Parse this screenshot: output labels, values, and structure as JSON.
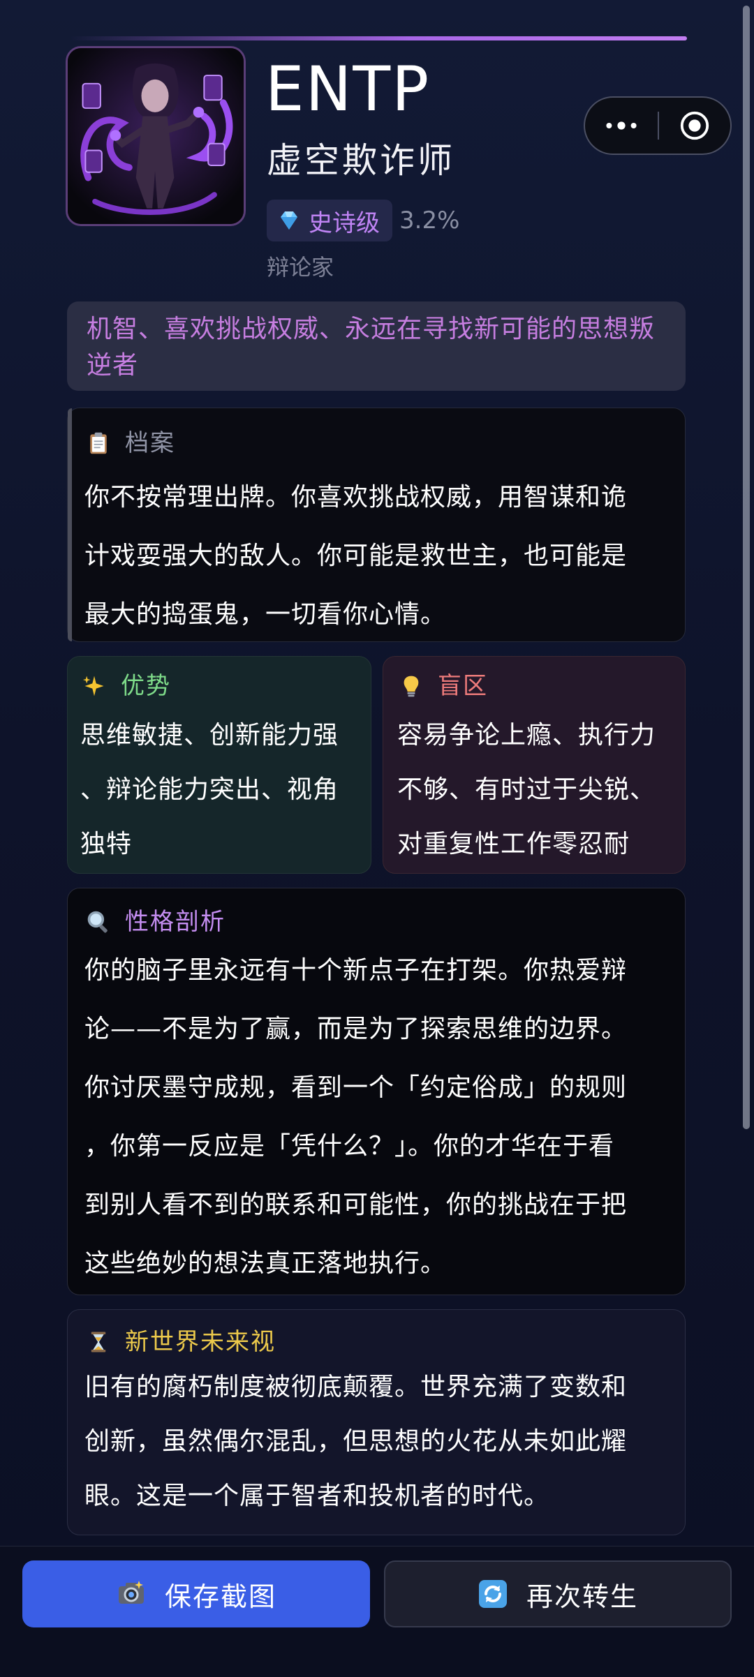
{
  "header": {
    "title": "ENTP",
    "subtitle": "虚空欺诈师",
    "rarity": "史诗级",
    "percent": "3.2%",
    "nickname": "辩论家",
    "avatar_icon": "void-trickster-portrait",
    "accent_color": "#a766e6"
  },
  "capsule": {
    "more_icon": "more-dots-icon",
    "close_icon": "target-close-icon"
  },
  "tagline": "机智、喜欢挑战权威、永远在寻找新可能的思想叛逆者",
  "profile": {
    "icon": "clipboard-icon",
    "title": "档案",
    "lines": [
      "你不按常理出牌。你喜欢挑战权威，用智谋和诡",
      "计戏耍强大的敌人。你可能是救世主，也可能是",
      "最大的捣蛋鬼，一切看你心情。"
    ]
  },
  "strengths": {
    "icon": "sparkles-icon",
    "title": "优势",
    "lines": [
      "思维敏捷、创新能力强",
      "、辩论能力突出、视角",
      "独特"
    ]
  },
  "blindspots": {
    "icon": "lightbulb-icon",
    "title": "盲区",
    "lines": [
      "容易争论上瘾、执行力",
      "不够、有时过于尖锐、",
      "对重复性工作零忍耐"
    ]
  },
  "analysis": {
    "icon": "magnifier-icon",
    "title": "性格剖析",
    "lines": [
      "你的脑子里永远有十个新点子在打架。你热爱辩",
      "论——不是为了赢，而是为了探索思维的边界。",
      "你讨厌墨守成规，看到一个「约定俗成」的规则",
      "，你第一反应是「凭什么？」。你的才华在于看",
      "到别人看不到的联系和可能性，你的挑战在于把",
      "这些绝妙的想法真正落地执行。"
    ]
  },
  "future": {
    "icon": "hourglass-icon",
    "title": "新世界未来视",
    "lines": [
      "旧有的腐朽制度被彻底颠覆。世界充满了变数和",
      "创新，虽然偶尔混乱，但思想的火花从未如此耀",
      "眼。这是一个属于智者和投机者的时代。"
    ]
  },
  "actions": {
    "save_label": "保存截图",
    "save_icon": "camera-icon",
    "rebirth_label": "再次转生",
    "rebirth_icon": "refresh-icon",
    "save_color": "#3a5ee6"
  }
}
